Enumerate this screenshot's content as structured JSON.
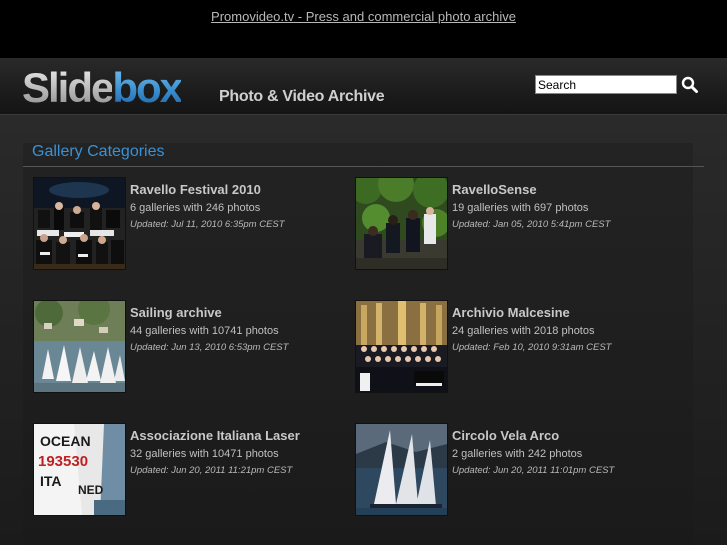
{
  "top_link": "Promovideo.tv - Press and commercial photo archive",
  "header": {
    "logo_part1": "Slide",
    "logo_part2": "box",
    "tagline": "Photo & Video Archive",
    "search_value": "Search",
    "search_icon": "magnifier-icon"
  },
  "section": {
    "title": "Gallery Categories"
  },
  "galleries": [
    {
      "title": "Ravello Festival 2010",
      "count": "6 galleries with 246 photos",
      "updated": "Updated: Jul 11, 2010 6:35pm CEST"
    },
    {
      "title": "RavelloSense",
      "count": "19 galleries with 697 photos",
      "updated": "Updated: Jan 05, 2010 5:41pm CEST"
    },
    {
      "title": "Sailing archive",
      "count": "44 galleries with 10741 photos",
      "updated": "Updated: Jun 13, 2010 6:53pm CEST"
    },
    {
      "title": "Archivio Malcesine",
      "count": "24 galleries with 2018 photos",
      "updated": "Updated: Feb 10, 2010 9:31am CEST"
    },
    {
      "title": "Associazione Italiana Laser",
      "count": "32 galleries with 10471 photos",
      "updated": "Updated: Jun 20, 2011 11:21pm CEST"
    },
    {
      "title": "Circolo Vela Arco",
      "count": "2 galleries with 242 photos",
      "updated": "Updated: Jun 20, 2011 11:01pm CEST"
    }
  ],
  "thumb_texts": {
    "laser_sail_1": "193530",
    "laser_sail_2": "ITA",
    "laser_sail_3": "NED",
    "laser_sail_4": "OCEAN"
  }
}
